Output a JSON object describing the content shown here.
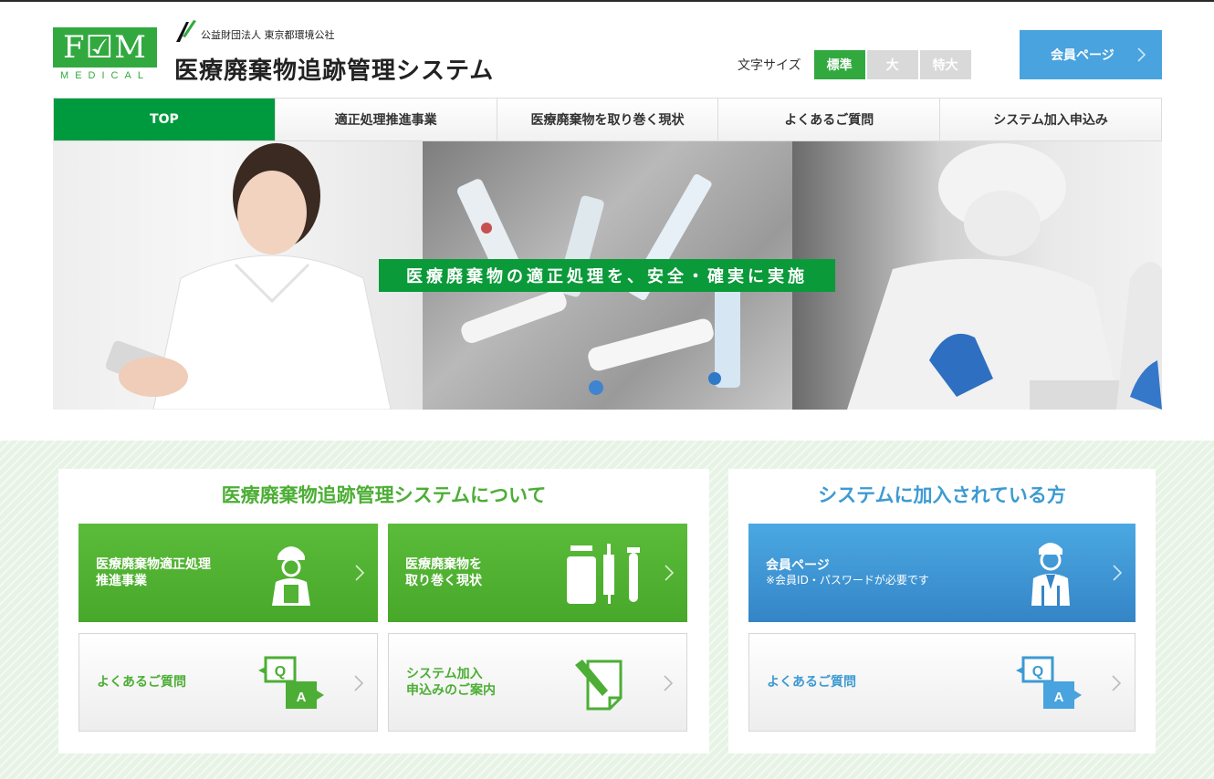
{
  "header": {
    "logo_text": "F☑M",
    "logo_sub": "MEDICAL",
    "org_name": "公益財団法人 東京都環境公社",
    "site_title": "医療廃棄物追跡管理システム",
    "font_size_label": "文字サイズ",
    "font_sizes": [
      "標準",
      "大",
      "特大"
    ],
    "font_size_active": "標準",
    "member_button": "会員ページ"
  },
  "nav": {
    "items": [
      "TOP",
      "適正処理推進事業",
      "医療廃棄物を取り巻く現状",
      "よくあるご質問",
      "システム加入申込み"
    ],
    "active": "TOP"
  },
  "hero": {
    "caption": "医療廃棄物の適正処理を、安全・確実に実施"
  },
  "about": {
    "title": "医療廃棄物追跡管理システムについて",
    "tiles": [
      {
        "line1": "医療廃棄物適正処理",
        "line2": "推進事業",
        "icon": "worker-clipboard-icon"
      },
      {
        "line1": "医療廃棄物を",
        "line2": "取り巻く現状",
        "icon": "medical-vials-icon"
      },
      {
        "line1": "よくあるご質問",
        "line2": "",
        "icon": "qa-icon"
      },
      {
        "line1": "システム加入",
        "line2": "申込みのご案内",
        "icon": "application-form-icon"
      }
    ]
  },
  "member": {
    "title": "システムに加入されている方",
    "tiles": [
      {
        "line1": "会員ページ",
        "line2": "※会員ID・パスワードが必要です",
        "icon": "doctor-icon"
      },
      {
        "line1": "よくあるご質問",
        "line2": "",
        "icon": "qa-icon"
      }
    ]
  },
  "colors": {
    "green": "#32a93f",
    "nav_active": "#009a3e",
    "blue": "#48a3df",
    "tile_green": "#52b334",
    "title_blue": "#3d9ad2"
  }
}
